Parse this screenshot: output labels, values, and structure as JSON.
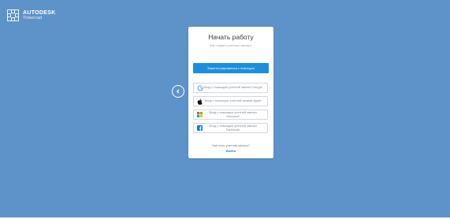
{
  "brand": {
    "name": "AUTODESK",
    "product": "Tinkercad"
  },
  "card": {
    "title": "Начать работу",
    "subtitle": "Как создать учетную запись?",
    "register_label": "Зарегистрироваться с помощью",
    "providers": [
      {
        "icon": "google-icon",
        "label": "Вход с помощью учетной записи Google"
      },
      {
        "icon": "apple-icon",
        "label": "Вход с помощью учетной записи Apple"
      },
      {
        "icon": "microsoft-icon",
        "label": "Вход с помощью учетной записи Microsoft"
      },
      {
        "icon": "facebook-icon",
        "label": "Вход с помощью учетной записи Facebook"
      }
    ],
    "login_question": "Уже есть учетная запись?",
    "login_link": "Войти"
  },
  "colors": {
    "background": "#5e93c9",
    "primary": "#1a8fdf",
    "link": "#1a7fd0"
  }
}
